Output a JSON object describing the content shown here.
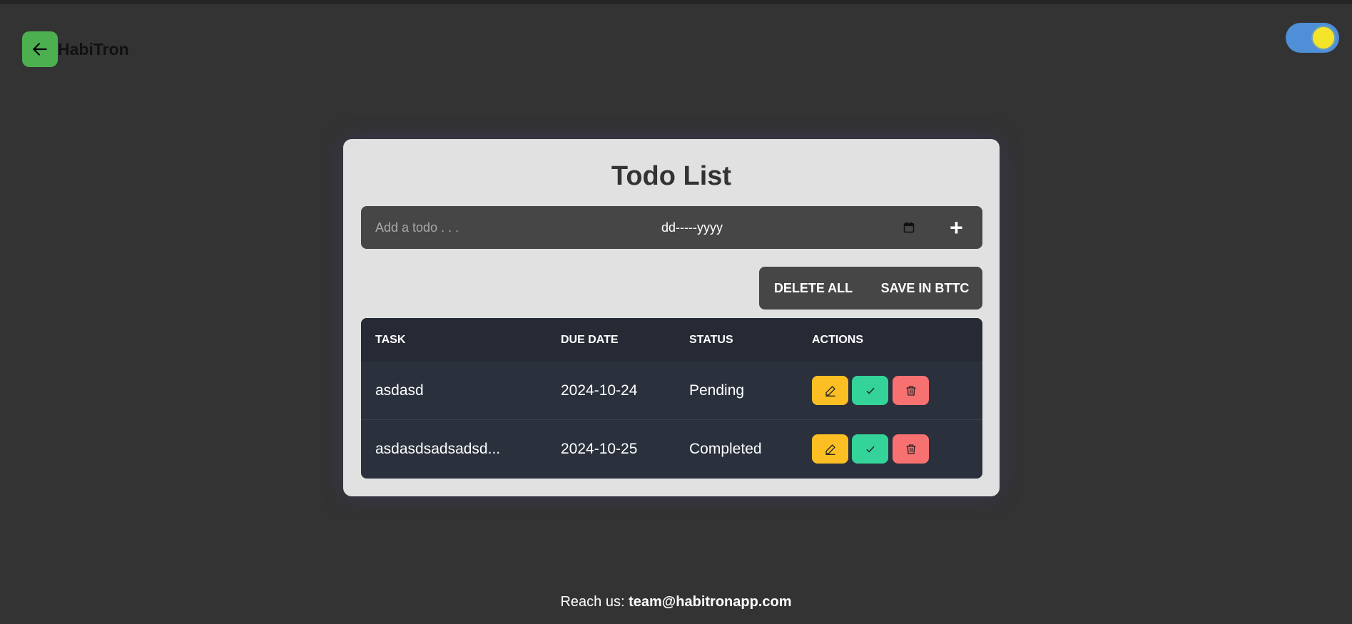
{
  "header": {
    "brand": "HabiTron"
  },
  "card": {
    "title": "Todo List",
    "todo_placeholder": "Add a todo . . .",
    "date_value": "dd-----yyyy",
    "add_label": "+",
    "delete_all_label": "DELETE ALL",
    "save_label": "SAVE IN BTTC"
  },
  "table": {
    "headers": [
      "TASK",
      "DUE DATE",
      "STATUS",
      "ACTIONS"
    ],
    "rows": [
      {
        "task": "asdasd",
        "due_date": "2024-10-24",
        "status": "Pending"
      },
      {
        "task": "asdasdsadsadsd...",
        "due_date": "2024-10-25",
        "status": "Completed"
      }
    ]
  },
  "footer": {
    "prefix": "Reach us: ",
    "email": "team@habitronapp.com"
  },
  "colors": {
    "background": "#333333",
    "card": "#e1e1e1",
    "back_button": "#4cb050",
    "edit": "#fbbf24",
    "complete": "#34d399",
    "delete": "#f87171",
    "toggle": "#4e8fd8",
    "sun": "#f5e52a"
  },
  "icons": [
    "arrow-left-icon",
    "sun-icon",
    "calendar-icon",
    "plus-icon",
    "pencil-icon",
    "check-icon",
    "trash-icon"
  ]
}
